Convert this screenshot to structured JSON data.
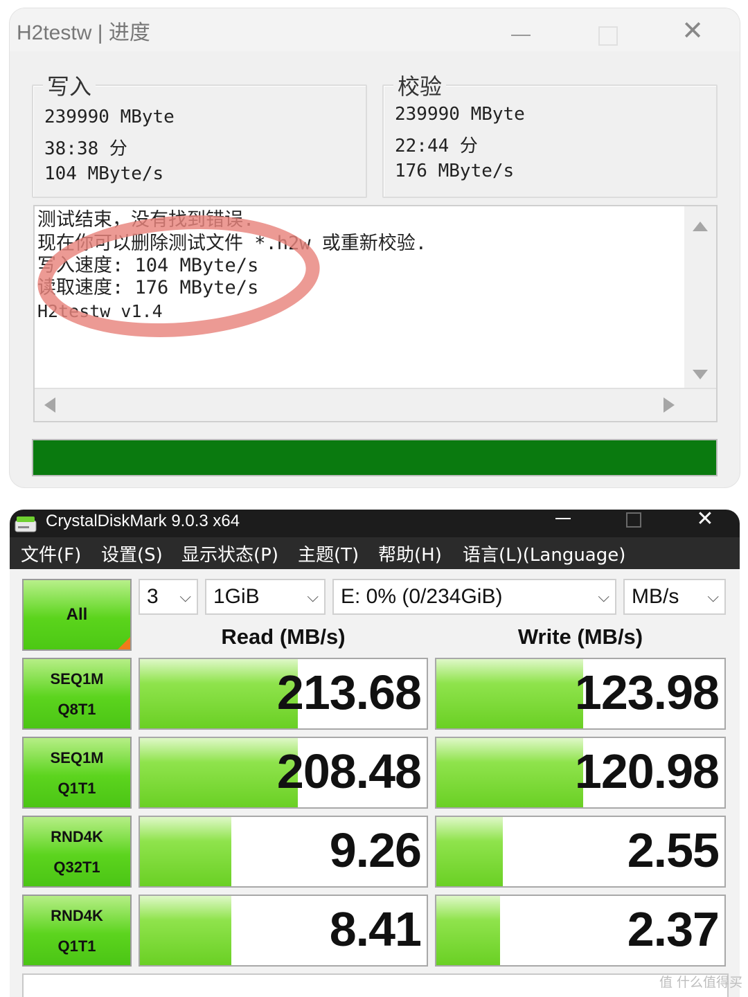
{
  "h2testw": {
    "title": "H2testw | 进度",
    "write": {
      "title": "写入",
      "size": "239990 MByte",
      "time": "38:38 分",
      "speed": "104 MByte/s"
    },
    "verify": {
      "title": "校验",
      "size": "239990 MByte",
      "time": "22:44 分",
      "speed": "176 MByte/s"
    },
    "log": [
      "测试结束，没有找到错误.",
      "现在你可以删除测试文件 *.h2w 或重新校验.",
      "写入速度: 104 MByte/s",
      "读取速度: 176 MByte/s",
      "H2testw v1.4"
    ],
    "progress": 1.0,
    "progress_color": "#0a7a0f",
    "highlight_color": "#e8847c"
  },
  "cdm": {
    "title": "CrystalDiskMark 9.0.3 x64",
    "menu": [
      "文件(F)",
      "设置(S)",
      "显示状态(P)",
      "主题(T)",
      "帮助(H)",
      "语言(L)(Language)"
    ],
    "all_label": "All",
    "count": "3",
    "size": "1GiB",
    "drive": "E: 0% (0/234GiB)",
    "unit": "MB/s",
    "read_header": "Read (MB/s)",
    "write_header": "Write (MB/s)",
    "tests": [
      {
        "line1": "SEQ1M",
        "line2": "Q8T1",
        "read": "213.68",
        "write": "123.98",
        "read_fill": 0.55,
        "write_fill": 0.51
      },
      {
        "line1": "SEQ1M",
        "line2": "Q1T1",
        "read": "208.48",
        "write": "120.98",
        "read_fill": 0.55,
        "write_fill": 0.51
      },
      {
        "line1": "RND4K",
        "line2": "Q32T1",
        "read": "9.26",
        "write": "2.55",
        "read_fill": 0.32,
        "write_fill": 0.23
      },
      {
        "line1": "RND4K",
        "line2": "Q1T1",
        "read": "8.41",
        "write": "2.37",
        "read_fill": 0.32,
        "write_fill": 0.22
      }
    ],
    "accent_color": "#5cd41e"
  },
  "watermark": "值 什么值得买"
}
